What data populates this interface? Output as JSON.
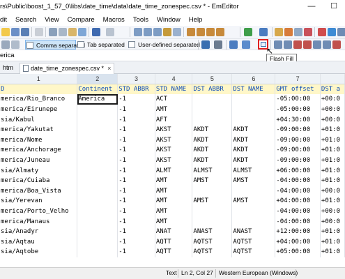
{
  "title": "rs\\Public\\boost_1_57_0\\libs\\date_time\\data\\date_time_zonespec.csv * - EmEditor",
  "menu": [
    "dit",
    "Search",
    "View",
    "Compare",
    "Macros",
    "Tools",
    "Window",
    "Help"
  ],
  "csv_modes": [
    "Comma separated",
    "Tab separated",
    "User-defined separated"
  ],
  "tooltip": "Flash Fill",
  "search_text": "erica",
  "tabs": [
    "htm",
    "date_time_zonespec.csv *"
  ],
  "column_numbers": [
    "1",
    "2",
    "3",
    "4",
    "5",
    "6",
    "7",
    ""
  ],
  "headers": [
    "D",
    "Continent",
    "STD ABBR",
    "STD NAME",
    "DST ABBR",
    "DST NAME",
    "GMT offset",
    "DST a"
  ],
  "rows": [
    [
      "merica/Rio_Branco",
      "America",
      "-1",
      "ACT",
      "",
      "",
      "-05:00:00",
      "+00:0"
    ],
    [
      "merica/Eirunepe",
      "",
      "-1",
      "AMT",
      "",
      "",
      "-05:00:00",
      "+00:0"
    ],
    [
      "sia/Kabul",
      "",
      "-1",
      "AFT",
      "",
      "",
      "+04:30:00",
      "+00:0"
    ],
    [
      "merica/Yakutat",
      "",
      "-1",
      "AKST",
      "AKDT",
      "AKDT",
      "-09:00:00",
      "+01:0"
    ],
    [
      "merica/Nome",
      "",
      "-1",
      "AKST",
      "AKDT",
      "AKDT",
      "-09:00:00",
      "+01:0"
    ],
    [
      "merica/Anchorage",
      "",
      "-1",
      "AKST",
      "AKDT",
      "AKDT",
      "-09:00:00",
      "+01:0"
    ],
    [
      "merica/Juneau",
      "",
      "-1",
      "AKST",
      "AKDT",
      "AKDT",
      "-09:00:00",
      "+01:0"
    ],
    [
      "sia/Almaty",
      "",
      "-1",
      "ALMT",
      "ALMST",
      "ALMST",
      "+06:00:00",
      "+01:0"
    ],
    [
      "merica/Cuiaba",
      "",
      "-1",
      "AMT",
      "AMST",
      "AMST",
      "-04:00:00",
      "+01:0"
    ],
    [
      "merica/Boa_Vista",
      "",
      "-1",
      "AMT",
      "",
      "",
      "-04:00:00",
      "+00:0"
    ],
    [
      "sia/Yerevan",
      "",
      "-1",
      "AMT",
      "AMST",
      "AMST",
      "+04:00:00",
      "+01:0"
    ],
    [
      "merica/Porto_Velho",
      "",
      "-1",
      "AMT",
      "",
      "",
      "-04:00:00",
      "+00:0"
    ],
    [
      "merica/Manaus",
      "",
      "-1",
      "AMT",
      "",
      "",
      "-04:00:00",
      "+00:0"
    ],
    [
      "sia/Anadyr",
      "",
      "-1",
      "ANAT",
      "ANAST",
      "ANAST",
      "+12:00:00",
      "+01:0"
    ],
    [
      "sia/Aqtau",
      "",
      "-1",
      "AQTT",
      "AQTST",
      "AQTST",
      "+04:00:00",
      "+01:0"
    ],
    [
      "sia/Aqtobe",
      "",
      "-1",
      "AQTT",
      "AQTST",
      "AQTST",
      "+05:00:00",
      "+01:0"
    ]
  ],
  "status": {
    "mode": "Text",
    "position": "Ln 2, Col 27",
    "encoding": "Western European (Windows)"
  },
  "colors": {
    "header_bg": "#fff7c8",
    "header_text": "#0a4ab8",
    "active_mode_bg": "#cde4f7",
    "flash_fill_outline": "#e02020"
  }
}
